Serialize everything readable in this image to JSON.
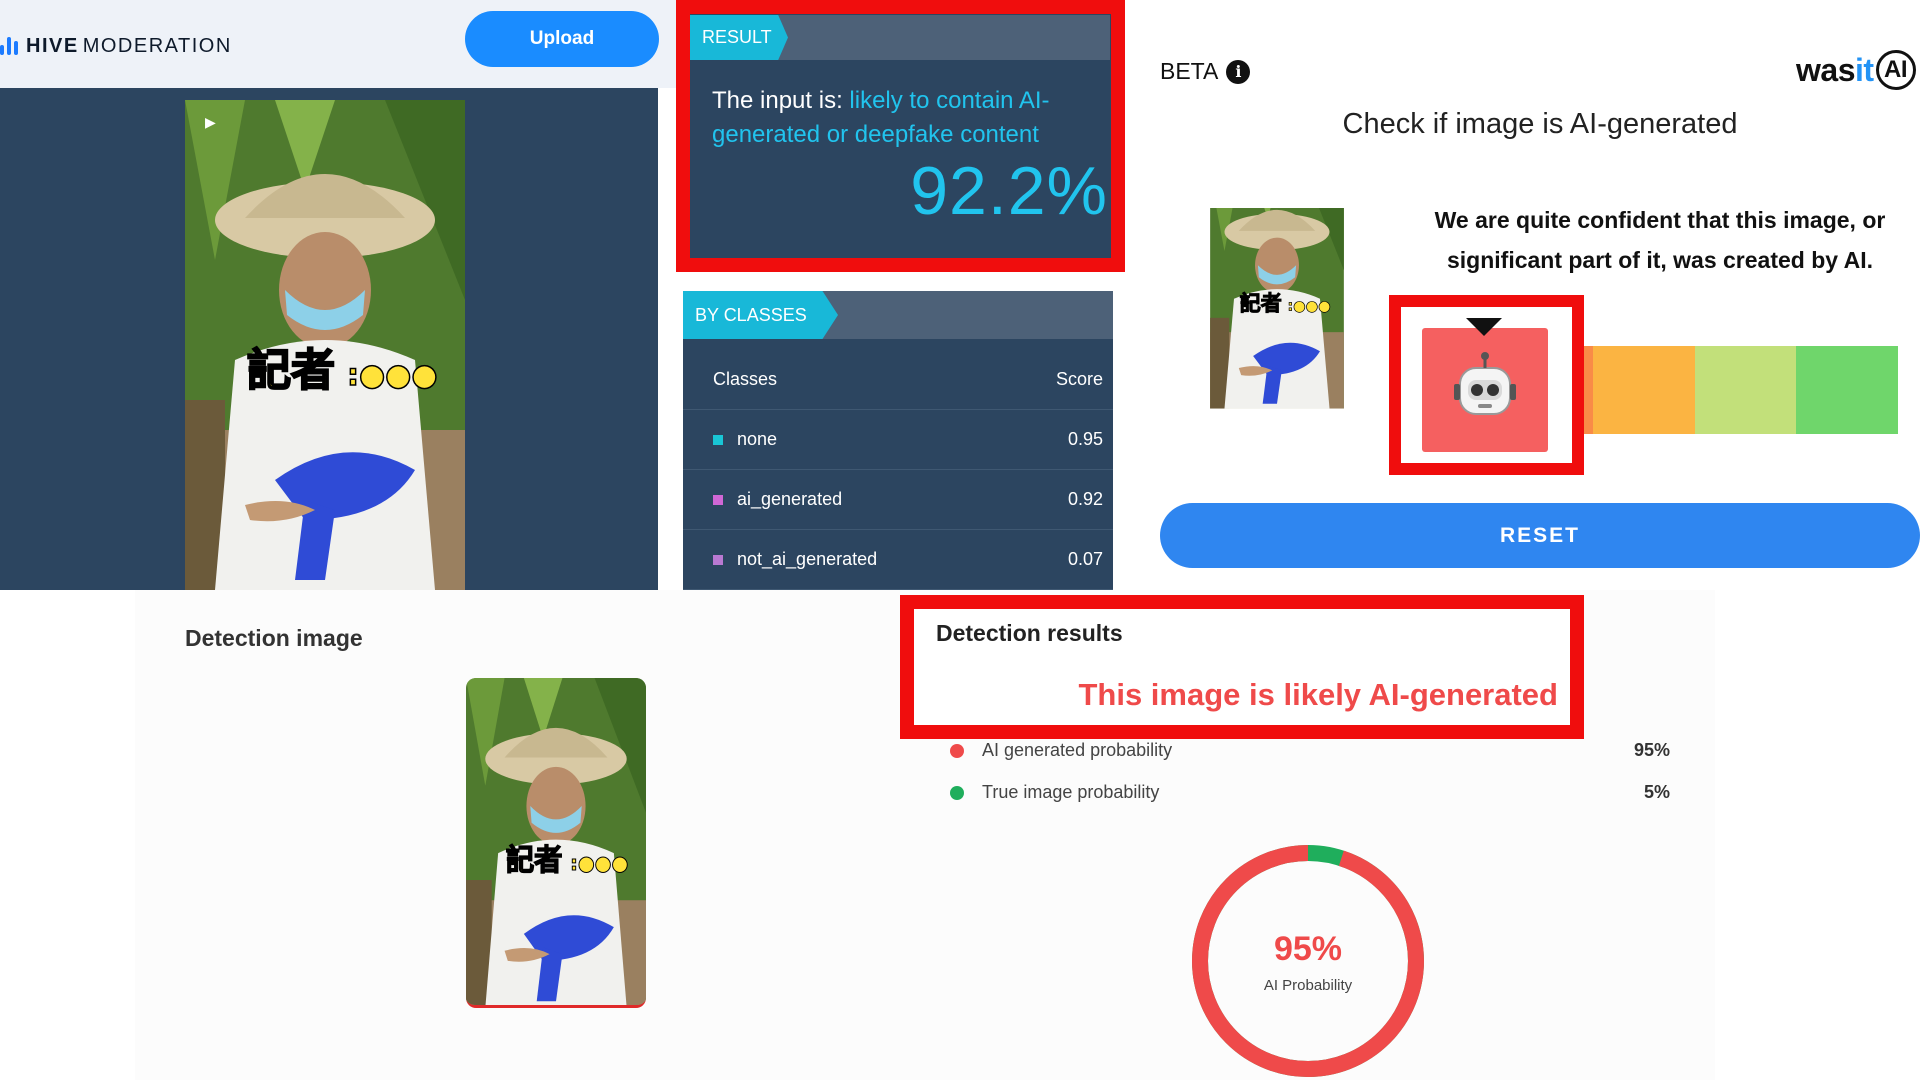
{
  "hive": {
    "brand_bold": "HIVE",
    "brand_light": "MODERATION",
    "upload_label": "Upload",
    "result_tag": "RESULT",
    "result_prefix": "The input is: ",
    "result_highlight": "likely to contain AI-generated or deepfake content",
    "result_percent": "92.2%",
    "classes_tag": "BY CLASSES",
    "col_classes": "Classes",
    "col_score": "Score",
    "classes": [
      {
        "name": "none",
        "score": "0.95",
        "color": "#19c6d6"
      },
      {
        "name": "ai_generated",
        "score": "0.92",
        "color": "#d067d6"
      },
      {
        "name": "not_ai_generated",
        "score": "0.07",
        "color": "#b979d2"
      }
    ]
  },
  "wasitai": {
    "beta_label": "BETA",
    "info_glyph": "i",
    "logo_was": "was",
    "logo_it": "it",
    "logo_ai": "AI",
    "title": "Check if image is AI-generated",
    "message": "We are quite confident that this image, or significant part of it, was created by AI.",
    "reset_label": "RESET",
    "scale_colors": [
      "#f56060",
      "#f98b47",
      "#fbb442",
      "#c2e07a",
      "#6fd66b"
    ]
  },
  "detector": {
    "image_title": "Detection image",
    "results_title": "Detection results",
    "verdict": "This image is likely AI-generated",
    "probabilities": [
      {
        "label": "AI generated probability",
        "value": "95%",
        "color": "#ef4a4a"
      },
      {
        "label": "True image probability",
        "value": "5%",
        "color": "#1fae5c"
      }
    ],
    "donut_value": "95%",
    "donut_label": "AI Probability",
    "donut_fraction": 0.95
  }
}
